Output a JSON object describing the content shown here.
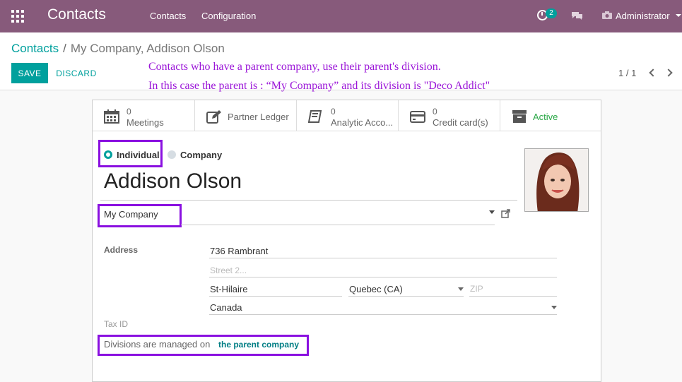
{
  "navbar": {
    "app_title": "Contacts",
    "menu": [
      "Contacts",
      "Configuration"
    ],
    "activity_count": "2",
    "user": "Administrator"
  },
  "breadcrumb": {
    "parent": "Contacts",
    "separator": "/",
    "current": "My Company, Addison Olson"
  },
  "actions": {
    "save": "SAVE",
    "discard": "DISCARD"
  },
  "annotation": {
    "line1": "Contacts who have a parent company, use their parent's division.",
    "line2": "In this case the parent is : “My Company” and its division is \"Deco Addict\""
  },
  "pager": {
    "text": "1 / 1"
  },
  "smart_buttons": [
    {
      "count": "0",
      "label": "Meetings",
      "icon": "calendar-icon"
    },
    {
      "count": "",
      "label": "Partner Ledger",
      "icon": "edit-icon"
    },
    {
      "count": "0",
      "label": "Analytic Acco...",
      "icon": "book-icon"
    },
    {
      "count": "0",
      "label": "Credit card(s)",
      "icon": "credit-card-icon"
    },
    {
      "count": "",
      "label": "Active",
      "icon": "archive-icon"
    }
  ],
  "company_type": {
    "individual": "Individual",
    "company": "Company",
    "selected": "individual"
  },
  "partner": {
    "name": "Addison Olson",
    "parent_company": "My Company"
  },
  "address": {
    "label": "Address",
    "street": "736 Rambrant",
    "street2_placeholder": "Street 2...",
    "city": "St-Hilaire",
    "state": "Quebec (CA)",
    "zip_placeholder": "ZIP",
    "country": "Canada"
  },
  "tax_id": {
    "label": "Tax ID"
  },
  "divisions": {
    "text": "Divisions are managed on",
    "link": "the parent company"
  },
  "colors": {
    "brand": "#875a7b",
    "accent": "#00a09d",
    "highlight": "#8a10e0",
    "annotation": "#9b16d8",
    "active": "#28a745"
  }
}
